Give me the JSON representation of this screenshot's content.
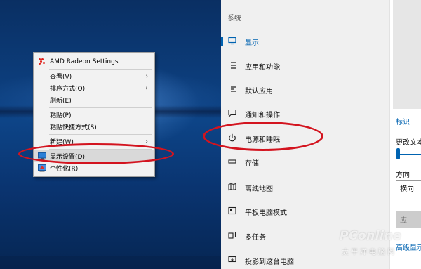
{
  "context_menu": {
    "amd": "AMD Radeon Settings",
    "view": "查看(V)",
    "sort": "排序方式(O)",
    "refresh": "刷新(E)",
    "paste": "粘贴(P)",
    "paste_shortcut": "粘贴快捷方式(S)",
    "new": "新建(W)",
    "display": "显示设置(D)",
    "personalize": "个性化(R)",
    "submenu_arrow": "›"
  },
  "settings": {
    "heading": "系统",
    "nav": [
      {
        "label": "显示",
        "icon": "monitor-icon"
      },
      {
        "label": "应用和功能",
        "icon": "list-icon"
      },
      {
        "label": "默认应用",
        "icon": "list-icon"
      },
      {
        "label": "通知和操作",
        "icon": "chat-icon"
      },
      {
        "label": "电源和睡眠",
        "icon": "power-icon"
      },
      {
        "label": "存储",
        "icon": "drive-icon"
      },
      {
        "label": "离线地图",
        "icon": "map-icon"
      },
      {
        "label": "平板电脑模式",
        "icon": "tablet-icon"
      },
      {
        "label": "多任务",
        "icon": "multitask-icon"
      },
      {
        "label": "投影到这台电脑",
        "icon": "project-icon"
      }
    ]
  },
  "right_pane": {
    "identify": "标识",
    "change_text": "更改文本",
    "orientation_label": "方向",
    "orientation_value": "横向",
    "apply": "应",
    "advanced": "高级显示"
  },
  "watermark": {
    "brand": "PConline",
    "sub": "太平洋电脑网"
  },
  "colors": {
    "accent": "#0063b1",
    "annotation": "#d3141f",
    "amd_red": "#e0201a"
  }
}
